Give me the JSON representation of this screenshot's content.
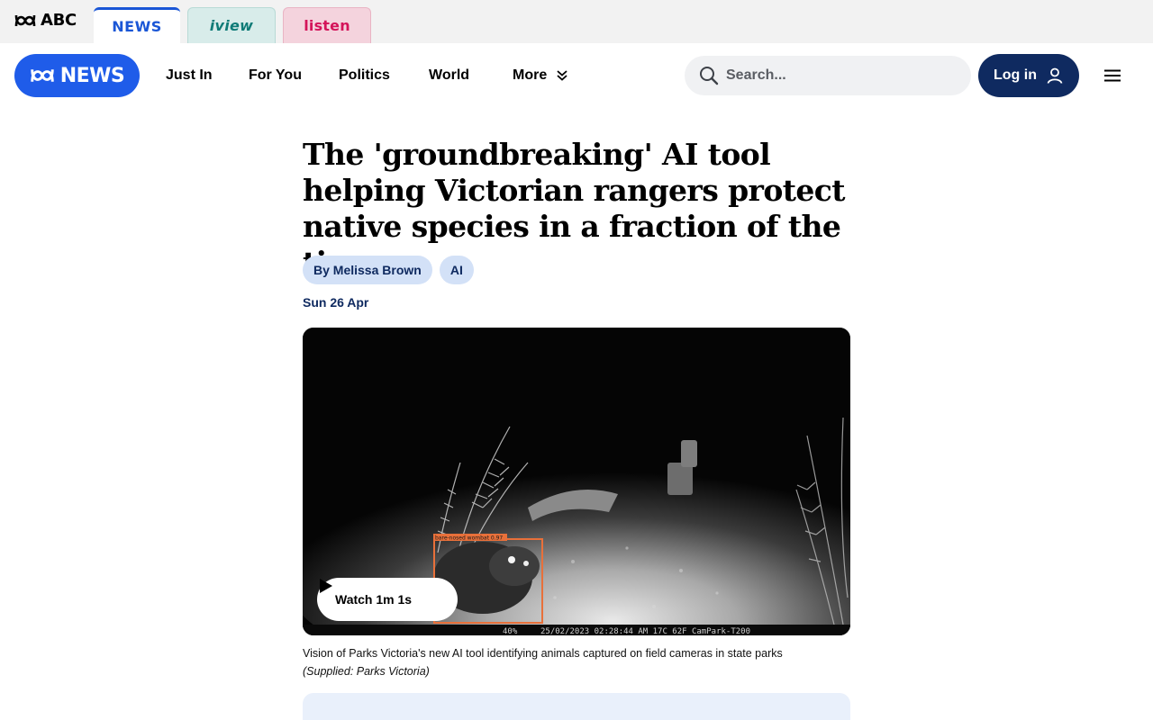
{
  "network_bar": {
    "abc_logo_text": "ABC",
    "tabs": [
      {
        "label": "NEWS",
        "active": true
      },
      {
        "label": "iview",
        "active": false
      },
      {
        "label": "listen",
        "active": false
      }
    ]
  },
  "header": {
    "logo_text": "NEWS",
    "nav": [
      "Just In",
      "For You",
      "Politics",
      "World"
    ],
    "more_label": "More",
    "search_placeholder": "Search...",
    "login_label": "Log in"
  },
  "article": {
    "headline": "The 'groundbreaking' AI tool helping Victorian rangers protect native species in a fraction of the time",
    "author": "By Melissa Brown",
    "topic": "AI",
    "date": "Sun 26 Apr",
    "video": {
      "watch_label": "Watch 1m 1s",
      "detection_label": "bare-nosed wombat 0.97",
      "overlay_battery": "40%",
      "overlay_stamp": "25/02/2023 02:28:44 AM 17C 62F CamPark-T200"
    },
    "caption": "Vision of Parks Victoria's new AI tool identifying animals captured on field cameras in state parks",
    "credit": "(Supplied: Parks Victoria)"
  },
  "colors": {
    "brand_blue": "#1f5ce9",
    "navy": "#0f2a60",
    "chip_bg": "#d3e1f7",
    "iview_teal": "#0f7b77",
    "listen_pink": "#d4145a",
    "detection_box": "#e8703a"
  }
}
